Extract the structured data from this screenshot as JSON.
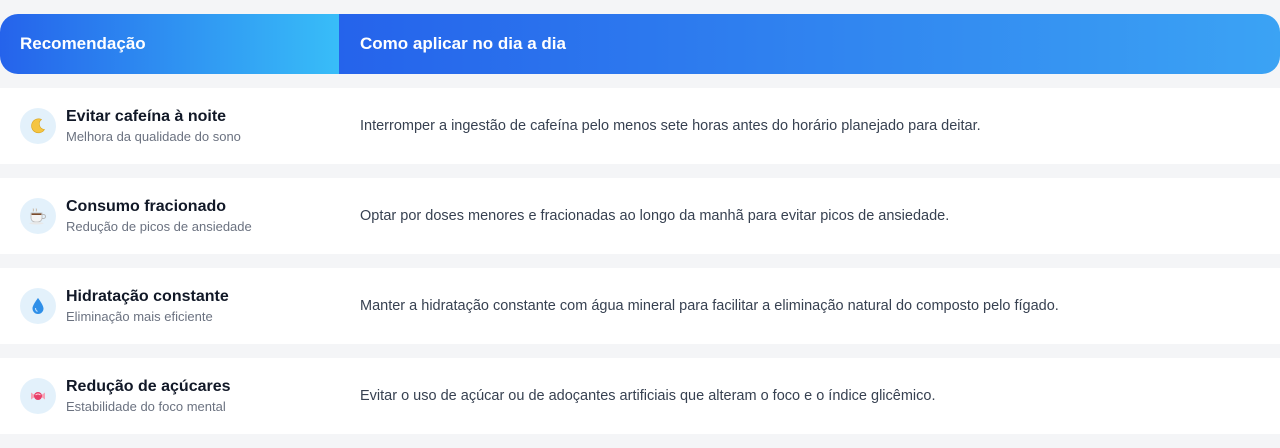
{
  "header": {
    "col_recommendation": "Recomendação",
    "col_apply": "Como aplicar no dia a dia"
  },
  "rows": [
    {
      "icon": "moon-icon",
      "title": "Evitar cafeína à noite",
      "subtitle": "Melhora da qualidade do sono",
      "apply": "Interromper a ingestão de cafeína pelo menos sete horas antes do horário planejado para deitar."
    },
    {
      "icon": "coffee-cup-icon",
      "title": "Consumo fracionado",
      "subtitle": "Redução de picos de ansiedade",
      "apply": "Optar por doses menores e fracionadas ao longo da manhã para evitar picos de ansiedade."
    },
    {
      "icon": "water-drop-icon",
      "title": "Hidratação constante",
      "subtitle": "Eliminação mais eficiente",
      "apply": "Manter a hidratação constante com água mineral para facilitar a eliminação natural do composto pelo fígado."
    },
    {
      "icon": "candy-icon",
      "title": "Redução de açúcares",
      "subtitle": "Estabilidade do foco mental",
      "apply": "Evitar o uso de açúcar ou de adoçantes artificiais que alteram o foco e o índice glicêmico."
    }
  ],
  "colors": {
    "header_gradient_start": "#2563eb",
    "header_gradient_end": "#38bdf8",
    "row_background": "#ffffff",
    "page_background": "#f4f5f7",
    "icon_badge": "#e3f1fb"
  }
}
